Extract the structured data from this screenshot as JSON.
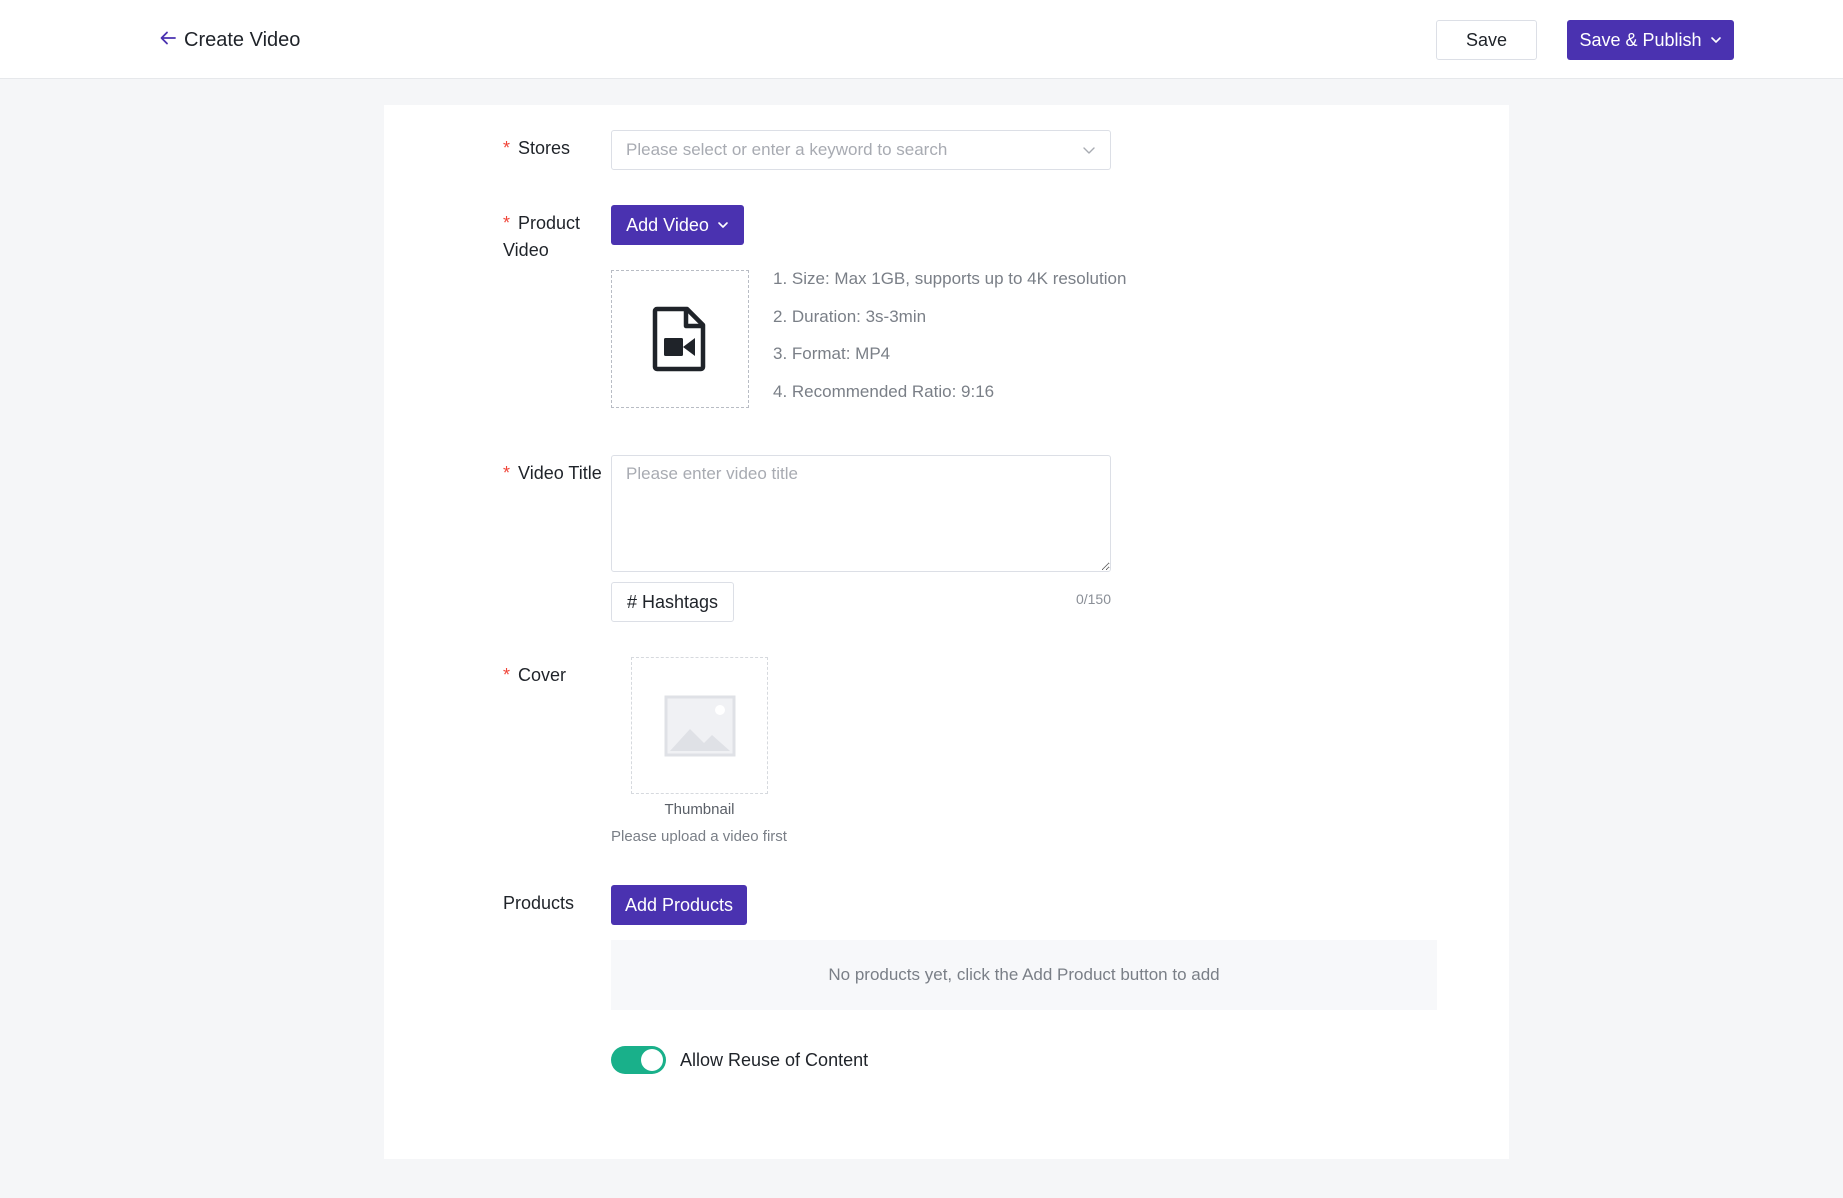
{
  "header": {
    "title": "Create Video",
    "save_label": "Save",
    "publish_label": "Save & Publish"
  },
  "form": {
    "stores": {
      "label": "Stores",
      "placeholder": "Please select or enter a keyword to search"
    },
    "product_video": {
      "label_line1": "Product",
      "label_line2": "Video",
      "add_button": "Add Video",
      "requirements": [
        "1. Size: Max 1GB, supports up to 4K resolution",
        "2. Duration: 3s-3min",
        "3. Format: MP4",
        "4. Recommended Ratio: 9:16"
      ]
    },
    "video_title": {
      "label": "Video Title",
      "placeholder": "Please enter video title",
      "value": "",
      "hashtags_button": "# Hashtags",
      "counter": "0/150"
    },
    "cover": {
      "label": "Cover",
      "thumbnail_label": "Thumbnail",
      "hint": "Please upload a video first"
    },
    "products": {
      "label": "Products",
      "add_button": "Add Products",
      "empty_text": "No products yet, click the Add Product button to add"
    },
    "reuse": {
      "label": "Allow Reuse of Content",
      "enabled": true
    }
  },
  "colors": {
    "primary": "#4a32b0",
    "required": "#f04438",
    "toggle_on": "#19b08a"
  },
  "icons": [
    "arrow-left-icon",
    "chevron-down-icon",
    "video-file-icon",
    "image-placeholder-icon"
  ]
}
